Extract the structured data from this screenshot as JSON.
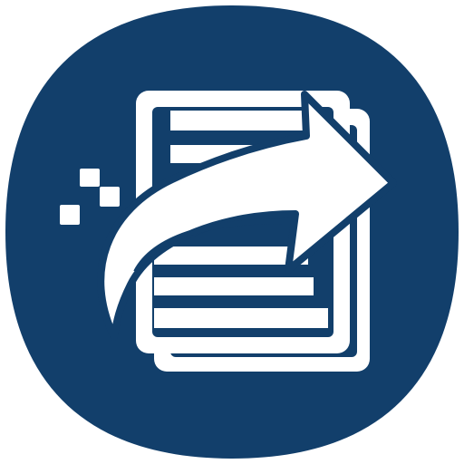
{
  "icon": {
    "name": "share-file-icon",
    "background_color": "#123f6b",
    "foreground_color": "#ffffff"
  }
}
